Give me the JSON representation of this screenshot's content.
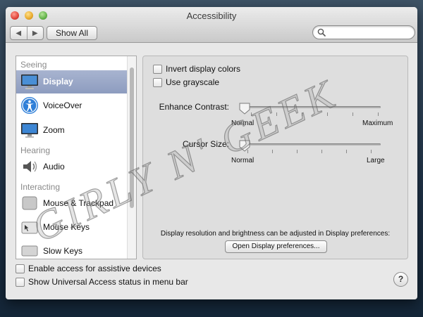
{
  "window": {
    "title": "Accessibility"
  },
  "toolbar": {
    "back_glyph": "◀",
    "forward_glyph": "▶",
    "show_all_label": "Show All",
    "search_placeholder": "",
    "search_value": ""
  },
  "sidebar": {
    "sections": [
      {
        "heading": "Seeing"
      },
      {
        "heading": "Hearing"
      },
      {
        "heading": "Interacting"
      }
    ],
    "items": [
      {
        "label": "Display",
        "icon": "display-icon",
        "selected": true
      },
      {
        "label": "VoiceOver",
        "icon": "voiceover-icon",
        "selected": false
      },
      {
        "label": "Zoom",
        "icon": "zoom-icon",
        "selected": false
      },
      {
        "label": "Audio",
        "icon": "speaker-icon",
        "selected": false
      },
      {
        "label": "Mouse & Trackpad",
        "icon": "trackpad-icon",
        "selected": false
      },
      {
        "label": "Mouse Keys",
        "icon": "mouse-keys-icon",
        "selected": false
      },
      {
        "label": "Slow Keys",
        "icon": "keyboard-icon",
        "selected": false
      }
    ]
  },
  "display_panel": {
    "invert_colors_label": "Invert display colors",
    "invert_colors_checked": false,
    "grayscale_label": "Use grayscale",
    "grayscale_checked": false,
    "enhance_contrast": {
      "label": "Enhance Contrast:",
      "min_label": "Normal",
      "max_label": "Maximum",
      "value": 0
    },
    "cursor_size": {
      "label": "Cursor Size:",
      "min_label": "Normal",
      "max_label": "Large",
      "value": 0
    },
    "note": "Display resolution and brightness can be adjusted in Display preferences:",
    "open_prefs_label": "Open Display preferences..."
  },
  "bottom": {
    "assistive_label": "Enable access for assistive devices",
    "assistive_checked": false,
    "status_label": "Show Universal Access status in menu bar",
    "status_checked": false,
    "help_label": "?"
  },
  "watermark": {
    "text": "GIRLY N' GEEK"
  },
  "colors": {
    "selection": "#8d9cbf",
    "desktop": "#20344a"
  }
}
